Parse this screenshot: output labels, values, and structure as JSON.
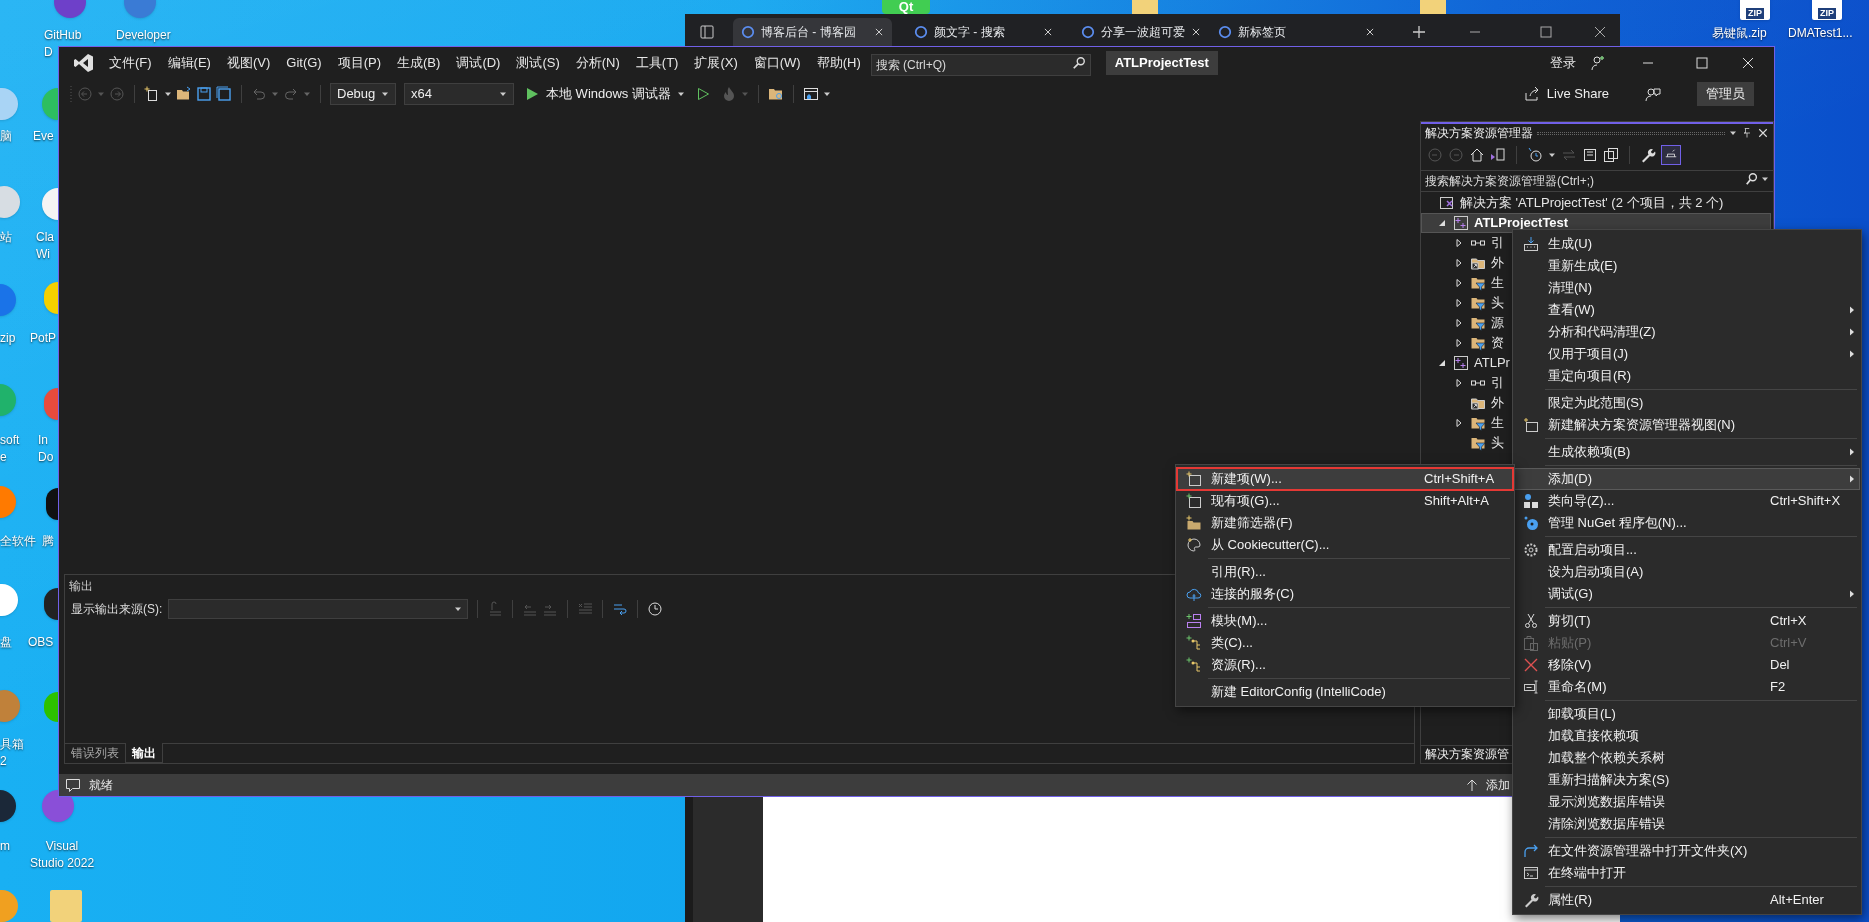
{
  "desktop": {
    "logo_text": "Qt",
    "icons": [
      {
        "lines": [
          "GitHub",
          "D"
        ]
      },
      {
        "lines": [
          "Developer"
        ]
      },
      {
        "lines": [
          "易键鼠.zip"
        ],
        "badge": "ZIP"
      },
      {
        "lines": [
          "DMATest1..."
        ],
        "badge": "ZIP"
      },
      {
        "lines": [
          "脑"
        ]
      },
      {
        "lines": [
          "Eve"
        ]
      },
      {
        "lines": [
          "站"
        ]
      },
      {
        "lines": [
          "Cla",
          "Wi"
        ]
      },
      {
        "lines": [
          "zip"
        ]
      },
      {
        "lines": [
          "PotP"
        ]
      },
      {
        "lines": [
          "soft",
          "e"
        ]
      },
      {
        "lines": [
          "In",
          "Do"
        ]
      },
      {
        "lines": [
          "全软件"
        ]
      },
      {
        "lines": [
          "腾"
        ]
      },
      {
        "lines": [
          "盘"
        ]
      },
      {
        "lines": [
          "OBS"
        ]
      },
      {
        "lines": [
          "具箱",
          "2"
        ]
      },
      {
        "lines": [
          "m"
        ]
      },
      {
        "lines": [
          "Visual",
          "Studio 2022"
        ]
      }
    ]
  },
  "browser": {
    "tabs": [
      {
        "label": "博客后台 - 博客园",
        "selected": true
      },
      {
        "label": "颜文字 - 搜索",
        "selected": false
      },
      {
        "label": "分享一波超可爱",
        "selected": false
      },
      {
        "label": "新标签页",
        "selected": false
      }
    ]
  },
  "vs": {
    "menus": [
      "文件(F)",
      "编辑(E)",
      "视图(V)",
      "Git(G)",
      "项目(P)",
      "生成(B)",
      "调试(D)",
      "测试(S)",
      "分析(N)",
      "工具(T)",
      "扩展(X)",
      "窗口(W)",
      "帮助(H)"
    ],
    "search_placeholder": "搜索 (Ctrl+Q)",
    "title": "ATLProjectTest",
    "sign_in": "登录",
    "toolbar": {
      "configuration": "Debug",
      "platform": "x64",
      "run_label": "本地 Windows 调试器"
    },
    "live_share": "Live Share",
    "admin": "管理员",
    "output": {
      "title": "输出",
      "source_label": "显示输出来源(S):",
      "tabs": [
        {
          "label": "错误列表",
          "selected": false
        },
        {
          "label": "输出",
          "selected": true
        }
      ]
    },
    "solution_explorer": {
      "title": "解决方案资源管理器",
      "search_placeholder": "搜索解决方案资源管理器(Ctrl+;)",
      "bottom_tab": "解决方案资源管",
      "tree": [
        {
          "kind": "solution",
          "label": "解决方案 'ATLProjectTest' (2 个项目，共 2 个)",
          "expandable": false,
          "selected": false,
          "children": [
            {
              "kind": "project",
              "label": "ATLProjectTest",
              "expandable": true,
              "expanded": true,
              "selected": true,
              "startup": true,
              "children": [
                {
                  "kind": "references",
                  "label": "引",
                  "expandable": true,
                  "expanded": false,
                  "selected": false
                },
                {
                  "kind": "external",
                  "label": "外",
                  "expandable": true,
                  "expanded": false,
                  "selected": false
                },
                {
                  "kind": "filter",
                  "label": "生",
                  "expandable": true,
                  "expanded": false,
                  "selected": false
                },
                {
                  "kind": "filter",
                  "label": "头",
                  "expandable": true,
                  "expanded": false,
                  "selected": false
                },
                {
                  "kind": "filter",
                  "label": "源",
                  "expandable": true,
                  "expanded": false,
                  "selected": false
                },
                {
                  "kind": "filter",
                  "label": "资",
                  "expandable": true,
                  "expanded": false,
                  "selected": false
                }
              ]
            },
            {
              "kind": "project",
              "label": "ATLPr",
              "expandable": true,
              "expanded": true,
              "selected": false,
              "startup": false,
              "children": [
                {
                  "kind": "references",
                  "label": "引",
                  "expandable": true,
                  "expanded": false,
                  "selected": false
                },
                {
                  "kind": "external",
                  "label": "外",
                  "expandable": false,
                  "selected": false
                },
                {
                  "kind": "filter",
                  "label": "生",
                  "expandable": true,
                  "expanded": false,
                  "selected": false
                },
                {
                  "kind": "filter",
                  "label": "头",
                  "expandable": false,
                  "selected": false
                }
              ]
            }
          ]
        }
      ]
    },
    "status_bar": {
      "text": "就绪",
      "right_text": "添加"
    }
  },
  "context_menu": {
    "items": [
      {
        "kind": "item",
        "label": "生成(U)",
        "selected": false,
        "disabled": false,
        "submenu": false
      },
      {
        "kind": "item",
        "label": "重新生成(E)",
        "selected": false,
        "disabled": false,
        "submenu": false
      },
      {
        "kind": "item",
        "label": "清理(N)",
        "selected": false,
        "disabled": false,
        "submenu": false
      },
      {
        "kind": "item",
        "label": "查看(W)",
        "selected": false,
        "disabled": false,
        "submenu": true
      },
      {
        "kind": "item",
        "label": "分析和代码清理(Z)",
        "selected": false,
        "disabled": false,
        "submenu": true
      },
      {
        "kind": "item",
        "label": "仅用于项目(J)",
        "selected": false,
        "disabled": false,
        "submenu": true
      },
      {
        "kind": "item",
        "label": "重定向项目(R)",
        "selected": false,
        "disabled": false,
        "submenu": false
      },
      {
        "kind": "separator"
      },
      {
        "kind": "item",
        "label": "限定为此范围(S)",
        "selected": false,
        "disabled": false,
        "submenu": false
      },
      {
        "kind": "item",
        "label": "新建解决方案资源管理器视图(N)",
        "selected": false,
        "disabled": false,
        "submenu": false
      },
      {
        "kind": "separator"
      },
      {
        "kind": "item",
        "label": "生成依赖项(B)",
        "selected": false,
        "disabled": false,
        "submenu": true
      },
      {
        "kind": "separator"
      },
      {
        "kind": "item",
        "label": "添加(D)",
        "selected": true,
        "disabled": false,
        "submenu": true
      },
      {
        "kind": "item",
        "label": "类向导(Z)...",
        "shortcut": "Ctrl+Shift+X",
        "selected": false,
        "disabled": false,
        "submenu": false
      },
      {
        "kind": "item",
        "label": "管理 NuGet 程序包(N)...",
        "selected": false,
        "disabled": false,
        "submenu": false
      },
      {
        "kind": "separator"
      },
      {
        "kind": "item",
        "label": "配置启动项目...",
        "selected": false,
        "disabled": false,
        "submenu": false
      },
      {
        "kind": "item",
        "label": "设为启动项目(A)",
        "selected": false,
        "disabled": false,
        "submenu": false
      },
      {
        "kind": "item",
        "label": "调试(G)",
        "selected": false,
        "disabled": false,
        "submenu": true
      },
      {
        "kind": "separator"
      },
      {
        "kind": "item",
        "label": "剪切(T)",
        "shortcut": "Ctrl+X",
        "selected": false,
        "disabled": false,
        "submenu": false
      },
      {
        "kind": "item",
        "label": "粘贴(P)",
        "shortcut": "Ctrl+V",
        "selected": false,
        "disabled": true,
        "submenu": false
      },
      {
        "kind": "item",
        "label": "移除(V)",
        "shortcut": "Del",
        "selected": false,
        "disabled": false,
        "submenu": false
      },
      {
        "kind": "item",
        "label": "重命名(M)",
        "shortcut": "F2",
        "selected": false,
        "disabled": false,
        "submenu": false
      },
      {
        "kind": "separator"
      },
      {
        "kind": "item",
        "label": "卸载项目(L)",
        "selected": false,
        "disabled": false,
        "submenu": false
      },
      {
        "kind": "item",
        "label": "加载直接依赖项",
        "selected": false,
        "disabled": false,
        "submenu": false
      },
      {
        "kind": "item",
        "label": "加载整个依赖关系树",
        "selected": false,
        "disabled": false,
        "submenu": false
      },
      {
        "kind": "item",
        "label": "重新扫描解决方案(S)",
        "selected": false,
        "disabled": false,
        "submenu": false
      },
      {
        "kind": "item",
        "label": "显示浏览数据库错误",
        "selected": false,
        "disabled": false,
        "submenu": false
      },
      {
        "kind": "item",
        "label": "清除浏览数据库错误",
        "selected": false,
        "disabled": false,
        "submenu": false
      },
      {
        "kind": "separator"
      },
      {
        "kind": "item",
        "label": "在文件资源管理器中打开文件夹(X)",
        "selected": false,
        "disabled": false,
        "submenu": false
      },
      {
        "kind": "item",
        "label": "在终端中打开",
        "selected": false,
        "disabled": false,
        "submenu": false
      },
      {
        "kind": "separator"
      },
      {
        "kind": "item",
        "label": "属性(R)",
        "shortcut": "Alt+Enter",
        "selected": false,
        "disabled": false,
        "submenu": false
      }
    ]
  },
  "submenu": {
    "items": [
      {
        "kind": "item",
        "label": "新建项(W)...",
        "shortcut": "Ctrl+Shift+A",
        "selected": true,
        "disabled": false
      },
      {
        "kind": "item",
        "label": "现有项(G)...",
        "shortcut": "Shift+Alt+A",
        "selected": false,
        "disabled": false
      },
      {
        "kind": "item",
        "label": "新建筛选器(F)",
        "selected": false,
        "disabled": false
      },
      {
        "kind": "item",
        "label": "从 Cookiecutter(C)...",
        "selected": false,
        "disabled": false
      },
      {
        "kind": "separator"
      },
      {
        "kind": "item",
        "label": "引用(R)...",
        "selected": false,
        "disabled": false
      },
      {
        "kind": "item",
        "label": "连接的服务(C)",
        "selected": false,
        "disabled": false
      },
      {
        "kind": "separator"
      },
      {
        "kind": "item",
        "label": "模块(M)...",
        "selected": false,
        "disabled": false
      },
      {
        "kind": "item",
        "label": "类(C)...",
        "selected": false,
        "disabled": false
      },
      {
        "kind": "item",
        "label": "资源(R)...",
        "selected": false,
        "disabled": false
      },
      {
        "kind": "separator"
      },
      {
        "kind": "item",
        "label": "新建 EditorConfig (IntelliCode)",
        "selected": false,
        "disabled": false
      }
    ]
  }
}
